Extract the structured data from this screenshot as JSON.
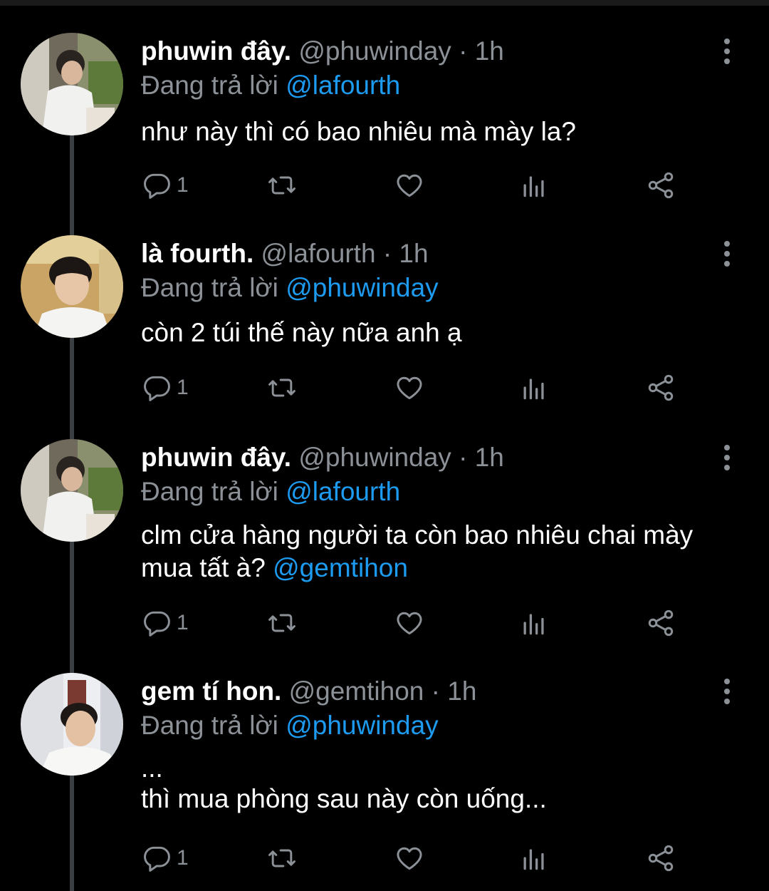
{
  "thread": [
    {
      "name": "phuwin đây.",
      "handle": "@phuwinday",
      "time": "1h",
      "reply_prefix": "Đang trả lời",
      "reply_to": "@lafourth",
      "text_lines": [
        "như này thì có bao nhiêu mà mày la?"
      ],
      "mention_line": "",
      "reply_count": "1",
      "avatar": "phuwin-avatar"
    },
    {
      "name": "là fourth.",
      "handle": "@lafourth",
      "time": "1h",
      "reply_prefix": "Đang trả lời",
      "reply_to": "@phuwinday",
      "text_lines": [
        "còn 2 túi thế này nữa anh ạ"
      ],
      "mention_line": "",
      "reply_count": "1",
      "avatar": "fourth-avatar"
    },
    {
      "name": "phuwin đây.",
      "handle": "@phuwinday",
      "time": "1h",
      "reply_prefix": "Đang trả lời",
      "reply_to": "@lafourth",
      "text_lines": [
        "clm cửa hàng người ta còn bao nhiêu chai mày",
        "mua tất à?"
      ],
      "mention_line": "@gemtihon",
      "reply_count": "1",
      "avatar": "phuwin-avatar"
    },
    {
      "name": "gem tí hon.",
      "handle": "@gemtihon",
      "time": "1h",
      "reply_prefix": "Đang trả lời",
      "reply_to": "@phuwinday",
      "text_lines": [
        "...",
        "thì mua phòng sau này còn uống..."
      ],
      "mention_line": "",
      "reply_count": "1",
      "avatar": "gem-avatar"
    }
  ],
  "separator": "·",
  "icons": {
    "reply": "reply-icon",
    "retweet": "retweet-icon",
    "like": "heart-icon",
    "views": "analytics-icon",
    "share": "share-icon",
    "more": "more-icon"
  },
  "colors": {
    "background": "#000000",
    "text": "#ffffff",
    "muted": "#8b9197",
    "mention": "#1d9bf0",
    "thread_line": "#3a3f44"
  }
}
